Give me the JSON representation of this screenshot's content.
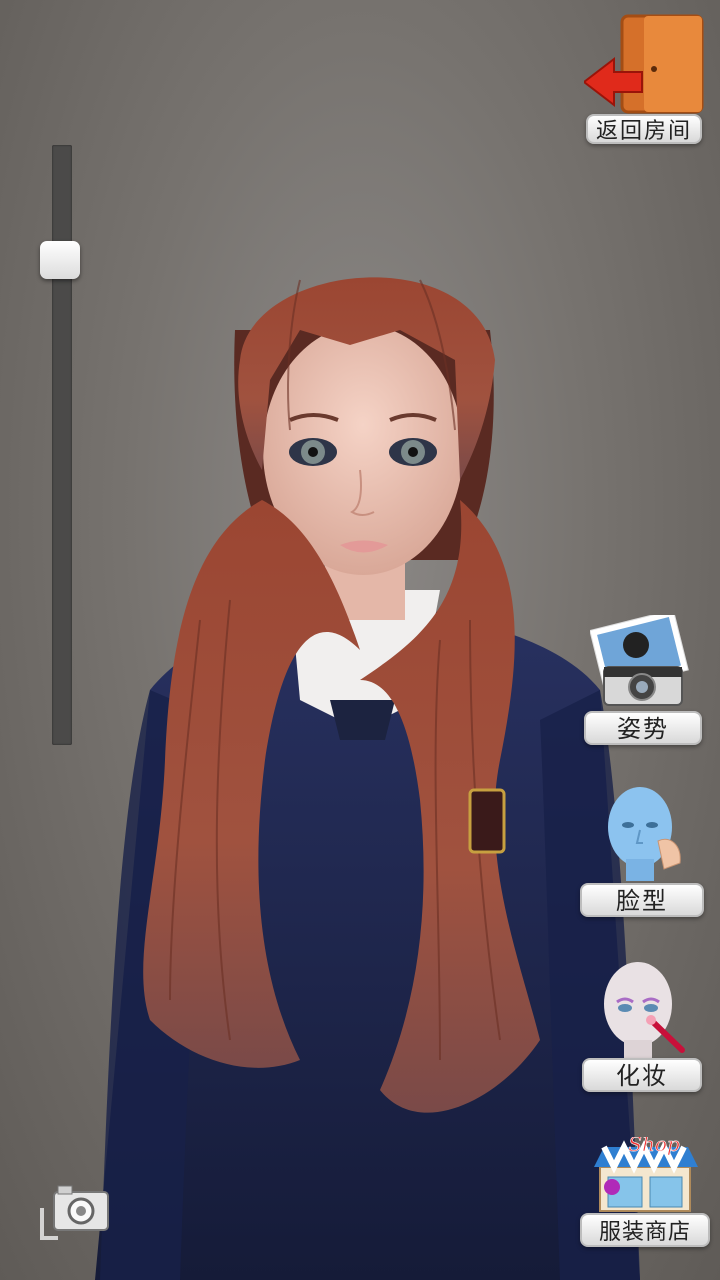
{
  "top_right": {
    "back_to_room_label": "返回房间"
  },
  "right_menu": {
    "pose_label": "姿势",
    "face_shape_label": "脸型",
    "makeup_label": "化妆",
    "clothing_store_label": "服装商店",
    "shop_sign": "Shop"
  },
  "zoom_slider": {
    "level": 0.17
  },
  "colors": {
    "background": "#77736f",
    "slider_track": "#4b4a49",
    "button_bg": "#eeeeee",
    "door": "#c8661f",
    "arrow": "#e02a1b",
    "hair": "#8a3d2c",
    "uniform": "#1d2448"
  },
  "icons": {
    "back": "door-exit-icon",
    "pose": "camera-photo-icon",
    "face": "face-touch-icon",
    "makeup": "makeup-brush-icon",
    "shop": "shop-storefront-icon",
    "screenshot": "camera-icon"
  }
}
